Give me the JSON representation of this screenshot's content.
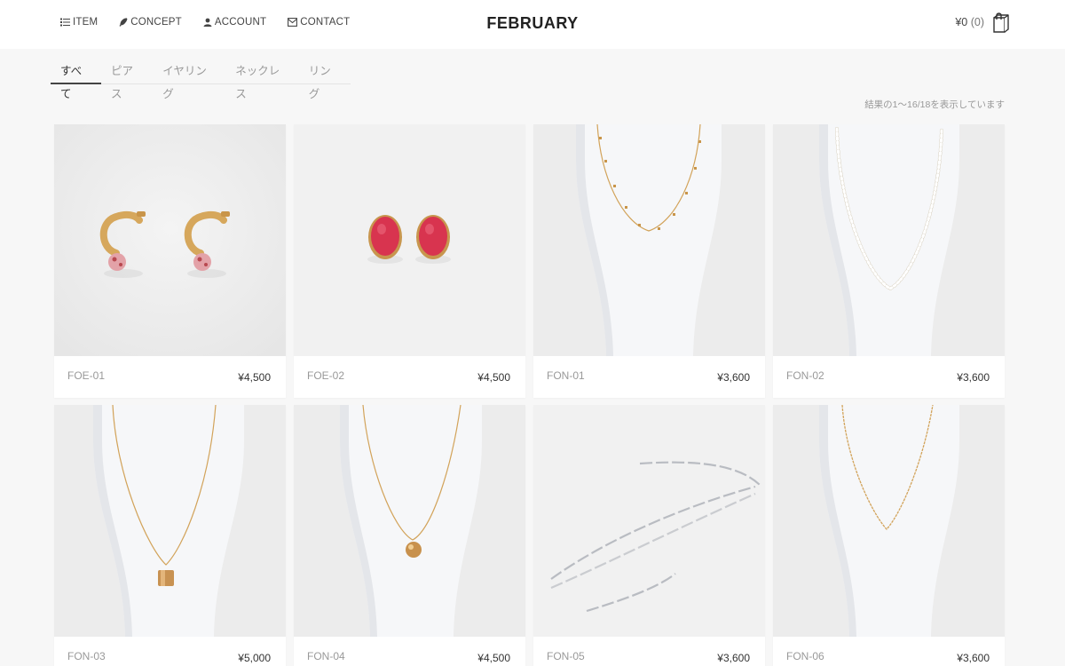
{
  "nav": [
    {
      "label": "ITEM",
      "icon": "list-icon"
    },
    {
      "label": "CONCEPT",
      "icon": "feather-icon"
    },
    {
      "label": "ACCOUNT",
      "icon": "person-icon"
    },
    {
      "label": "CONTACT",
      "icon": "mail-icon"
    }
  ],
  "brand": "FEBRUARY",
  "cart": {
    "total": "¥0",
    "count": "(0)",
    "icon": "shopping-bag-icon"
  },
  "tabs": [
    "すべて",
    "ピアス",
    "イヤリング",
    "ネックレス",
    "リング"
  ],
  "active_tab": "すべて",
  "results": "結果の1〜16/18を表示しています",
  "products": [
    {
      "code": "FOE-01",
      "price": "¥4,500",
      "image": "gold-hoop-earrings-pink-bead"
    },
    {
      "code": "FOE-02",
      "price": "¥4,500",
      "image": "red-oval-stone-earrings"
    },
    {
      "code": "FON-01",
      "price": "¥3,600",
      "image": "gold-station-chain-necklace"
    },
    {
      "code": "FON-02",
      "price": "¥3,600",
      "image": "pearl-beaded-necklace"
    },
    {
      "code": "FON-03",
      "price": "¥5,000",
      "image": "gold-chain-square-pendant-necklace"
    },
    {
      "code": "FON-04",
      "price": "¥4,500",
      "image": "gold-chain-ball-pendant-necklace"
    },
    {
      "code": "FON-05",
      "price": "¥3,600",
      "image": "silver-paperclip-chain"
    },
    {
      "code": "FON-06",
      "price": "¥3,600",
      "image": "gold-fine-chain-necklace"
    }
  ],
  "colors": {
    "accent": "#444444",
    "background": "#f7f7f7",
    "gold": "#d9a95a",
    "red_stone": "#d8344f"
  }
}
